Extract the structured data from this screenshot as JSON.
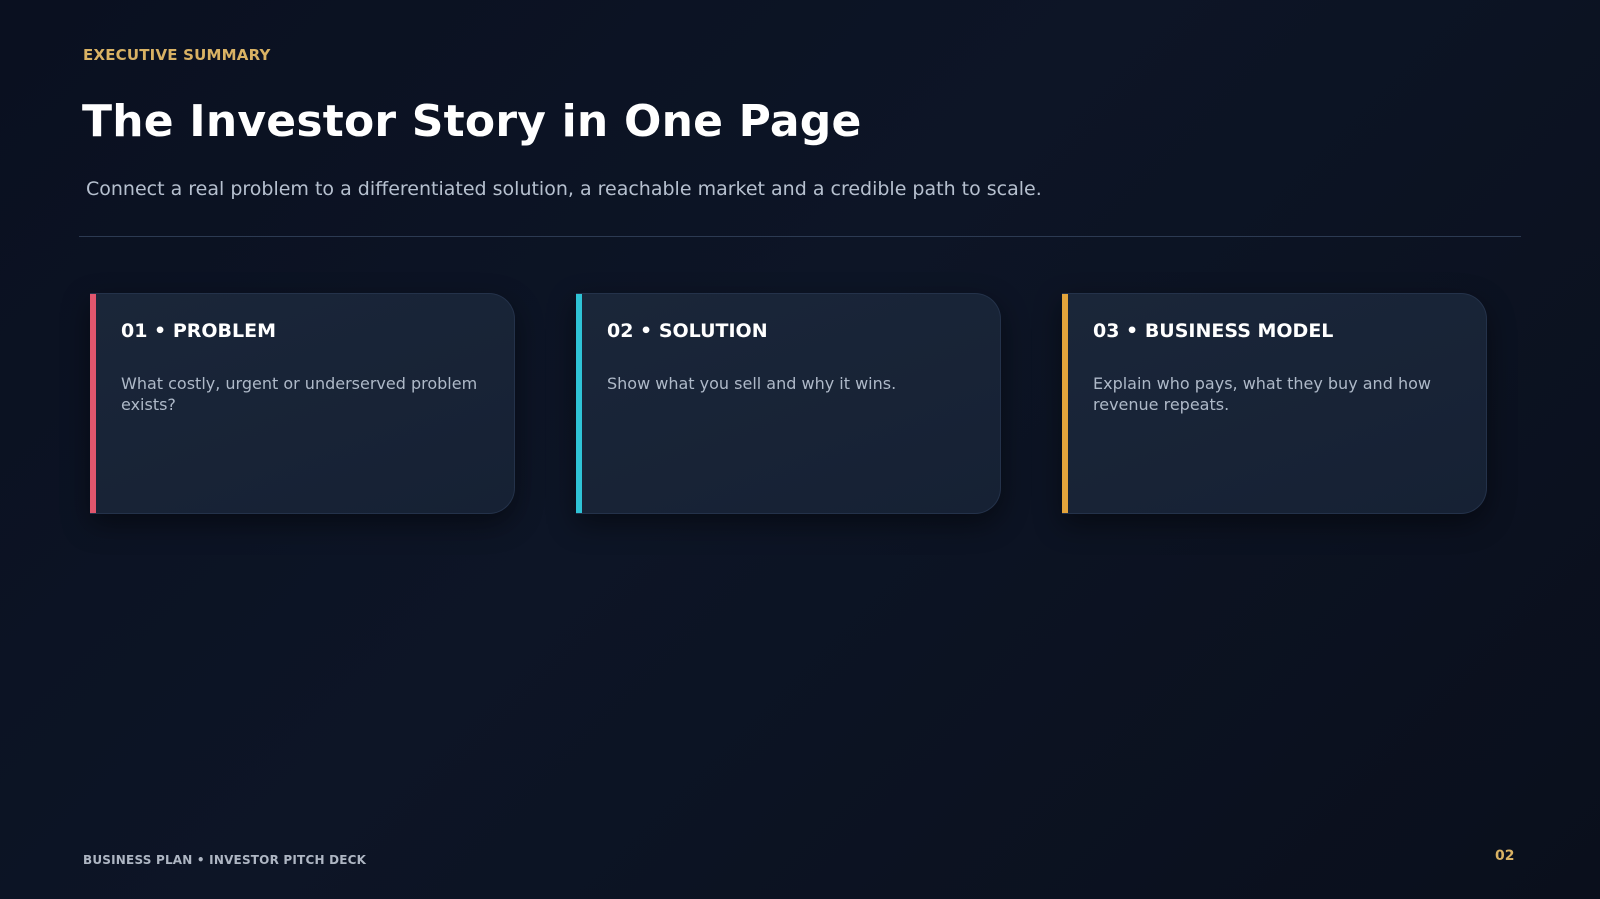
{
  "slide": {
    "eyebrow": "EXECUTIVE SUMMARY",
    "title": "The Investor Story in One Page",
    "subtitle": "Connect a real problem to a differentiated solution, a reachable market and a credible path to scale."
  },
  "cards": [
    {
      "title": "01 • PROBLEM",
      "body": "What costly, urgent or underserved problem exists?",
      "accent_color": "#e0566d"
    },
    {
      "title": "02 • SOLUTION",
      "body": "Show what you sell and why it wins.",
      "accent_color": "#2fc3d6"
    },
    {
      "title": "03 • BUSINESS MODEL",
      "body": "Explain who pays, what they buy and how revenue repeats.",
      "accent_color": "#e3a43b"
    }
  ],
  "footer": {
    "label": "BUSINESS PLAN • INVESTOR PITCH DECK",
    "page_number": "02"
  },
  "colors": {
    "background": "#0b1120",
    "gold": "#d9b264",
    "card_background": "#18243a"
  }
}
